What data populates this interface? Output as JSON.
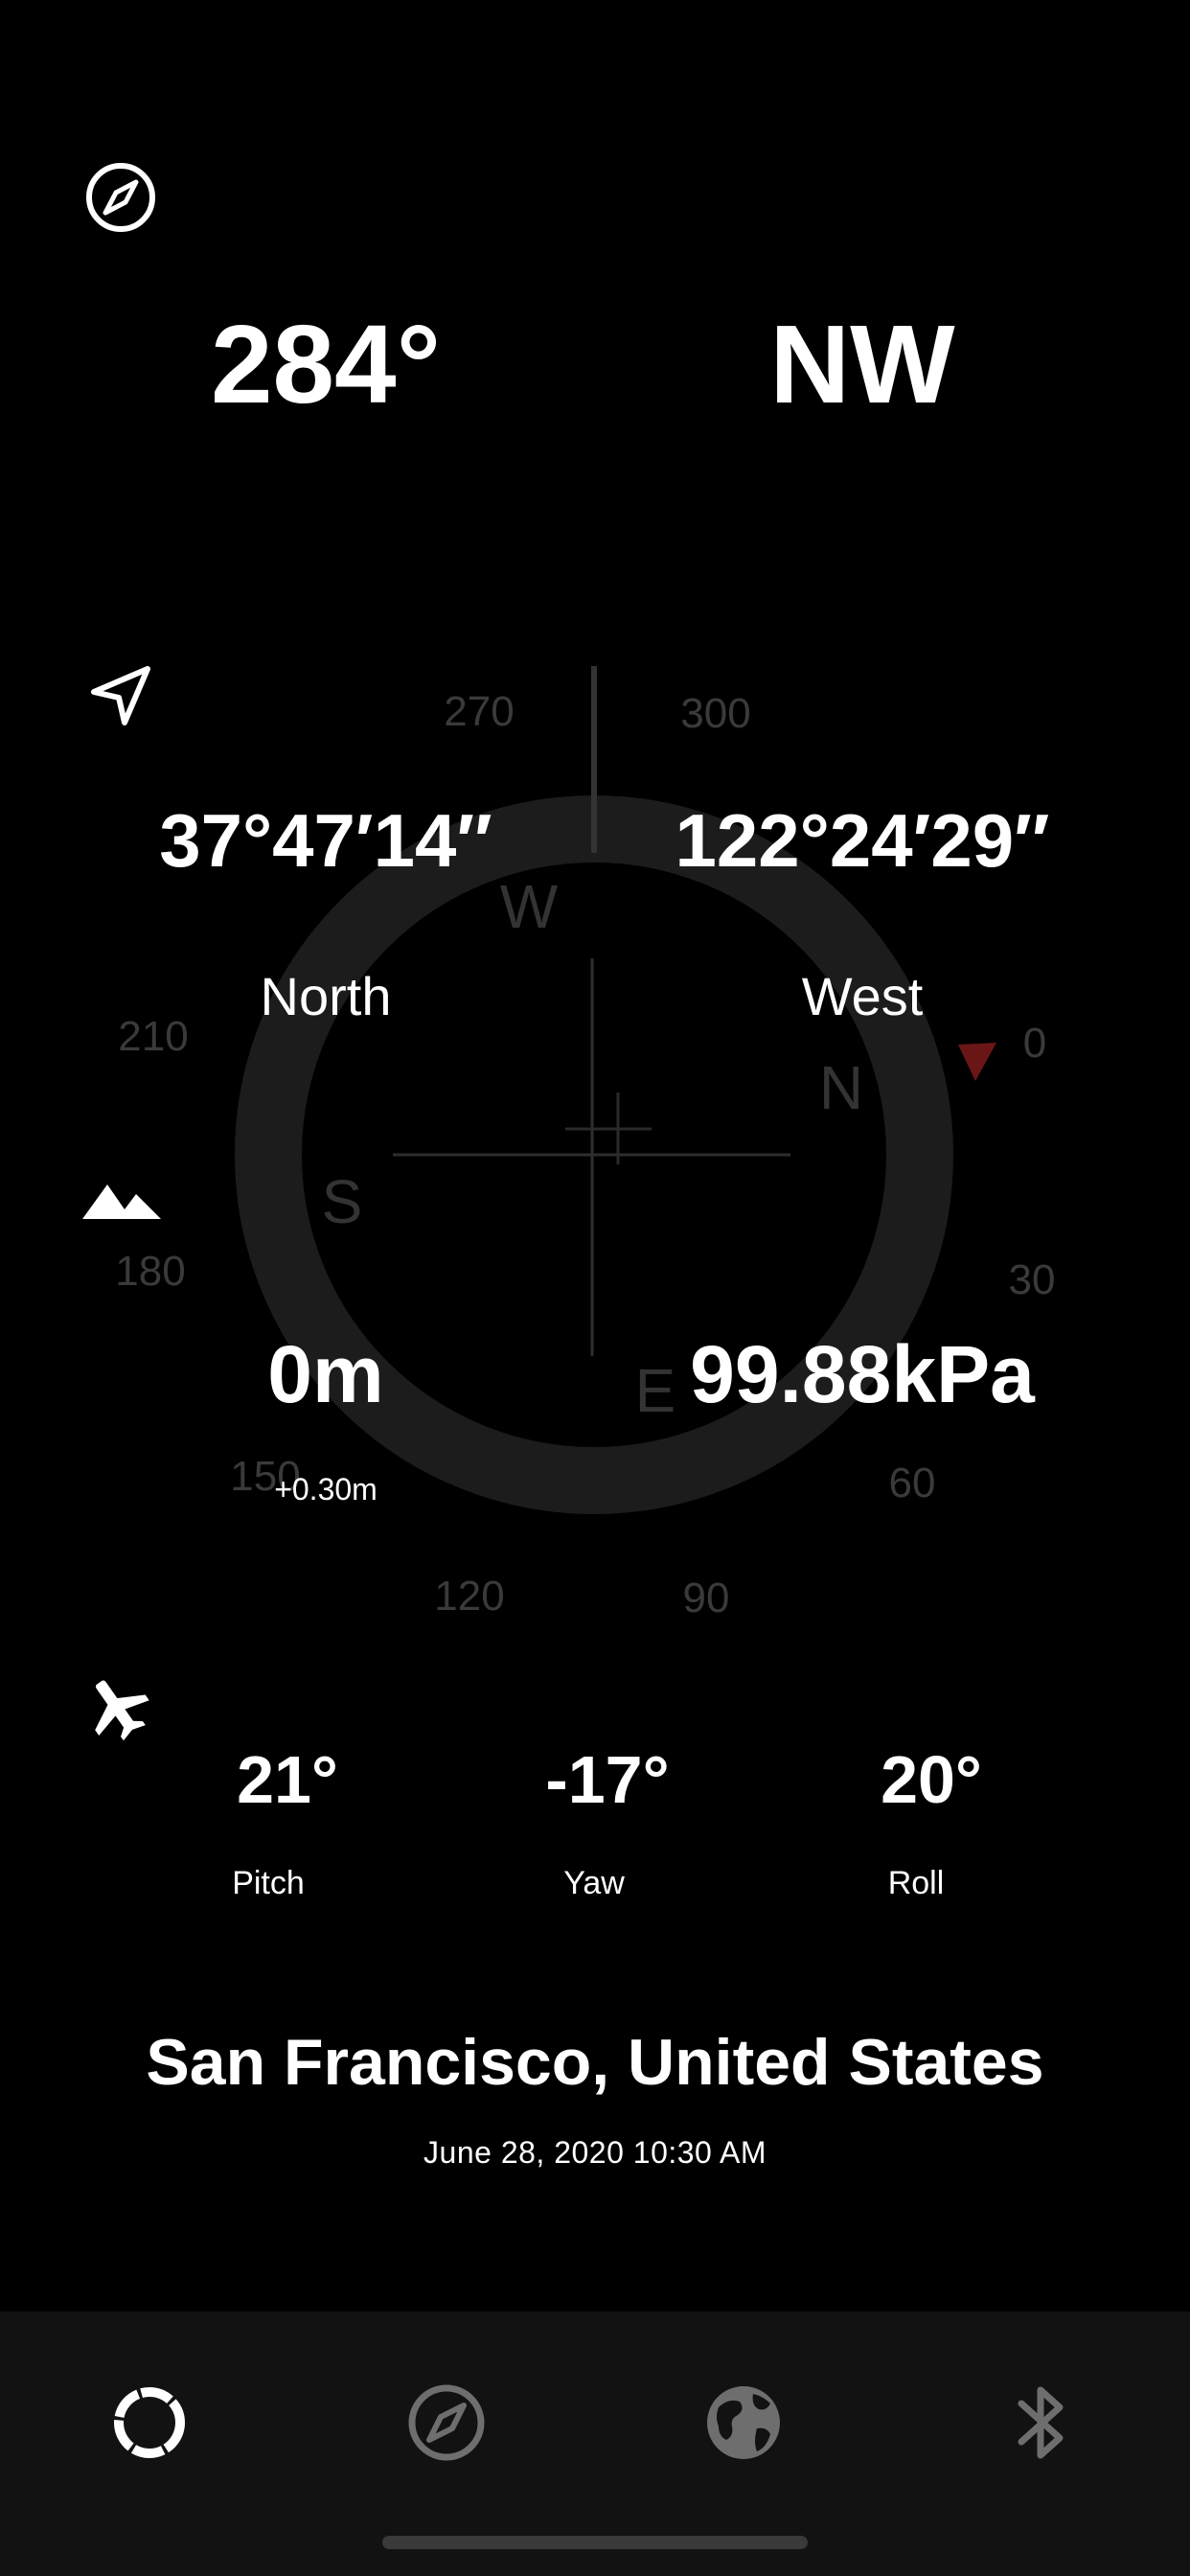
{
  "compass": {
    "heading": "284°",
    "direction": "NW",
    "dial_ticks": [
      "270",
      "300",
      "0",
      "30",
      "60",
      "90",
      "120",
      "150",
      "180",
      "210"
    ],
    "cardinals": [
      "N",
      "E",
      "S",
      "W"
    ]
  },
  "location": {
    "latitude": "37°47′14″",
    "longitude": "122°24′29″",
    "lat_hemisphere": "North",
    "lon_hemisphere": "West"
  },
  "altitude": {
    "altitude": "0m",
    "altitude_offset": "+0.30m",
    "pressure": "99.88kPa"
  },
  "attitude": {
    "pitch_value": "21°",
    "pitch_label": "Pitch",
    "yaw_value": "-17°",
    "yaw_label": "Yaw",
    "roll_value": "20°",
    "roll_label": "Roll"
  },
  "place": {
    "city": "San Francisco, United States",
    "datetime": "June 28, 2020 10:30 AM"
  },
  "tabbar": {
    "tabs": [
      {
        "icon": "dashboard-ring-icon",
        "active": true
      },
      {
        "icon": "compass-icon",
        "active": false
      },
      {
        "icon": "globe-icon",
        "active": false
      },
      {
        "icon": "bluetooth-icon",
        "active": false
      }
    ]
  },
  "colors": {
    "background": "#000000",
    "text": "#ffffff",
    "dim": "#3a3a3a",
    "tab_inactive": "#6e6e6e",
    "north_marker": "#8b1a1a"
  }
}
